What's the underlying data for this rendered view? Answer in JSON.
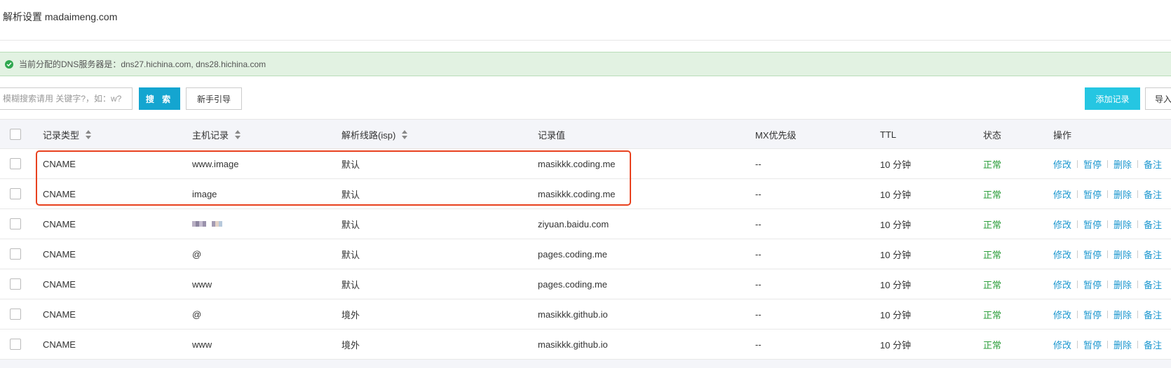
{
  "page": {
    "title": "解析设置 madaimeng.com"
  },
  "dns_banner": {
    "text": "当前分配的DNS服务器是：dns27.hichina.com, dns28.hichina.com",
    "icon": "check-circle-icon",
    "color": "#2fa84f"
  },
  "toolbar": {
    "search_placeholder": "模糊搜索请用 关键字?，如：w?",
    "search_label": "搜 索",
    "guide_label": "新手引导",
    "add_label": "添加记录",
    "import_label": "导入"
  },
  "table": {
    "headers": {
      "type": "记录类型",
      "host": "主机记录",
      "line": "解析线路(isp)",
      "value": "记录值",
      "mx": "MX优先级",
      "ttl": "TTL",
      "status": "状态",
      "ops": "操作"
    },
    "op_labels": {
      "edit": "修改",
      "pause": "暂停",
      "delete": "删除",
      "note": "备注"
    },
    "rows": [
      {
        "type": "CNAME",
        "host": "www.image",
        "line": "默认",
        "value": "masikkk.coding.me",
        "mx": "--",
        "ttl": "10 分钟",
        "status": "正常"
      },
      {
        "type": "CNAME",
        "host": "image",
        "line": "默认",
        "value": "masikkk.coding.me",
        "mx": "--",
        "ttl": "10 分钟",
        "status": "正常"
      },
      {
        "type": "CNAME",
        "host": "",
        "line": "默认",
        "value": "ziyuan.baidu.com",
        "mx": "--",
        "ttl": "10 分钟",
        "status": "正常"
      },
      {
        "type": "CNAME",
        "host": "@",
        "line": "默认",
        "value": "pages.coding.me",
        "mx": "--",
        "ttl": "10 分钟",
        "status": "正常"
      },
      {
        "type": "CNAME",
        "host": "www",
        "line": "默认",
        "value": "pages.coding.me",
        "mx": "--",
        "ttl": "10 分钟",
        "status": "正常"
      },
      {
        "type": "CNAME",
        "host": "@",
        "line": "境外",
        "value": "masikkk.github.io",
        "mx": "--",
        "ttl": "10 分钟",
        "status": "正常"
      },
      {
        "type": "CNAME",
        "host": "www",
        "line": "境外",
        "value": "masikkk.github.io",
        "mx": "--",
        "ttl": "10 分钟",
        "status": "正常"
      }
    ]
  },
  "colors": {
    "accent": "#14a5d0",
    "add_button": "#25c6e2",
    "status_ok": "#2b9e3a",
    "link": "#1c97cf",
    "highlight": "#e8411e"
  }
}
